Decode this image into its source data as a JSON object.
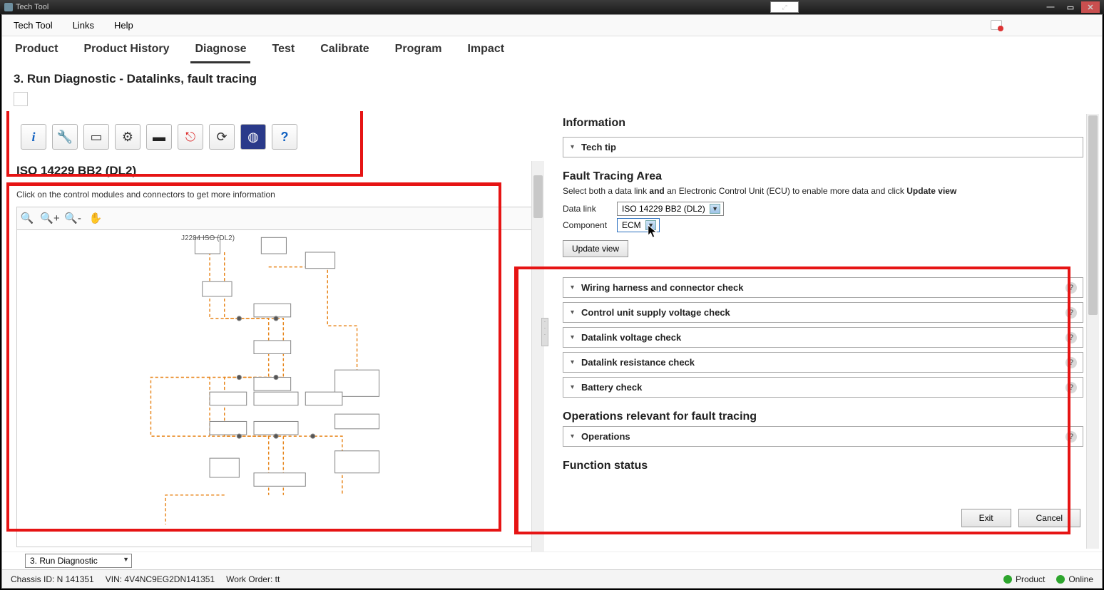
{
  "titlebar": {
    "title": "Tech Tool"
  },
  "menubar": {
    "items": [
      "Tech Tool",
      "Links",
      "Help"
    ]
  },
  "tabs": [
    "Product",
    "Product History",
    "Diagnose",
    "Test",
    "Calibrate",
    "Program",
    "Impact"
  ],
  "active_tab_index": 2,
  "page_title": "3. Run Diagnostic - Datalinks, fault tracing",
  "left": {
    "toolbar_icons": [
      "info",
      "wrench",
      "note",
      "gear-doc",
      "battery",
      "plug",
      "refresh",
      "globe",
      "help"
    ],
    "section_title": "ISO 14229 BB2 (DL2)",
    "hint": "Click on the control modules and connectors to get more information",
    "diagram_controls": [
      "zoom-fit",
      "zoom-in",
      "zoom-out",
      "pan"
    ],
    "diagram_title": "J2284 ISO (DL2)"
  },
  "right": {
    "info_heading": "Information",
    "tech_tip": "Tech tip",
    "fault_tracing_heading": "Fault Tracing Area",
    "instruction_pre": "Select both a data link ",
    "instruction_bold1": "and",
    "instruction_mid": " an Electronic Control Unit (ECU) to enable more data and click ",
    "instruction_bold2": "Update view",
    "data_link_label": "Data link",
    "data_link_value": "ISO 14229 BB2 (DL2)",
    "component_label": "Component",
    "component_value": "ECM",
    "update_view": "Update view",
    "checks": [
      "Wiring harness and connector check",
      "Control unit supply voltage check",
      "Datalink voltage check",
      "Datalink resistance check",
      "Battery check"
    ],
    "ops_heading": "Operations relevant for fault tracing",
    "operations": "Operations",
    "func_status": "Function status"
  },
  "footer": {
    "combo": "3. Run Diagnostic",
    "exit": "Exit",
    "cancel": "Cancel"
  },
  "statusbar": {
    "chassis_label": "Chassis ID: N 141351",
    "vin_label": "VIN: 4V4NC9EG2DN141351",
    "work_order": "Work Order: tt",
    "product": "Product",
    "online": "Online"
  }
}
